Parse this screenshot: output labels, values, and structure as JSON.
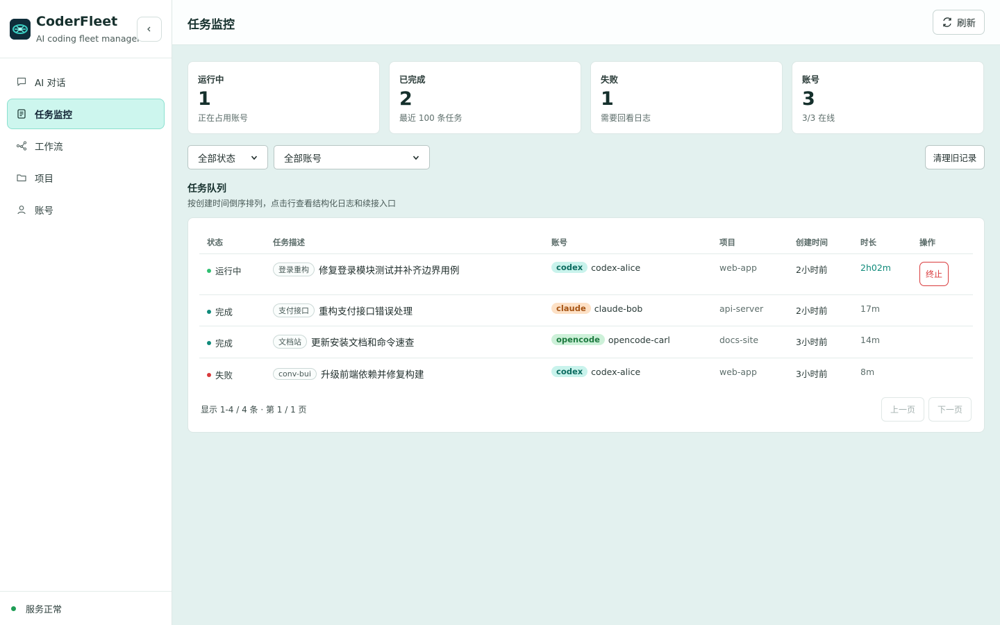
{
  "brand": {
    "name": "CoderFleet",
    "subtitle": "AI coding fleet manager"
  },
  "nav": [
    {
      "label": "AI 对话",
      "icon": "chat-icon",
      "active": false
    },
    {
      "label": "任务监控",
      "icon": "task-icon",
      "active": true
    },
    {
      "label": "工作流",
      "icon": "workflow-icon",
      "active": false
    },
    {
      "label": "项目",
      "icon": "folder-icon",
      "active": false
    },
    {
      "label": "账号",
      "icon": "user-icon",
      "active": false
    }
  ],
  "service_status": "服务正常",
  "header": {
    "title": "任务监控",
    "refresh_label": "刷新"
  },
  "stats": [
    {
      "label": "运行中",
      "value": "1",
      "sub": "正在占用账号"
    },
    {
      "label": "已完成",
      "value": "2",
      "sub": "最近 100 条任务"
    },
    {
      "label": "失败",
      "value": "1",
      "sub": "需要回看日志"
    },
    {
      "label": "账号",
      "value": "3",
      "sub": "3/3 在线"
    }
  ],
  "filters": {
    "status_selected": "全部状态",
    "account_selected": "全部账号",
    "clean_label": "清理旧记录"
  },
  "queue": {
    "title": "任务队列",
    "subtitle": "按创建时间倒序排列，点击行查看结构化日志和续接入口"
  },
  "table": {
    "columns": [
      "状态",
      "任务描述",
      "账号",
      "项目",
      "创建时间",
      "时长",
      "操作"
    ],
    "rows": [
      {
        "status": "运行中",
        "status_color": "#2fbf71",
        "tag": "登录重构",
        "desc": "修复登录模块测试并补齐边界用例",
        "agent": "codex",
        "account": "codex-alice",
        "project": "web-app",
        "created": "2小时前",
        "duration": "2h02m",
        "action": "终止"
      },
      {
        "status": "完成",
        "status_color": "#0f8a7a",
        "tag": "支付接口",
        "desc": "重构支付接口错误处理",
        "agent": "claude",
        "account": "claude-bob",
        "project": "api-server",
        "created": "2小时前",
        "duration": "17m",
        "action": ""
      },
      {
        "status": "完成",
        "status_color": "#0f8a7a",
        "tag": "文档站",
        "desc": "更新安装文档和命令速查",
        "agent": "opencode",
        "account": "opencode-carl",
        "project": "docs-site",
        "created": "3小时前",
        "duration": "14m",
        "action": ""
      },
      {
        "status": "失败",
        "status_color": "#d9393b",
        "tag": "conv-bui",
        "desc": "升级前端依赖并修复构建",
        "agent": "codex",
        "account": "codex-alice",
        "project": "web-app",
        "created": "3小时前",
        "duration": "8m",
        "action": ""
      }
    ]
  },
  "pagination": {
    "info": "显示 1-4 / 4 条 · 第 1 / 1 页",
    "prev_label": "上一页",
    "next_label": "下一页"
  },
  "colors": {
    "accent": "#0f8a7a",
    "codex_badge": "#c9f3ec",
    "claude_badge": "#fde1c6",
    "opencode_badge": "#cdf1d9",
    "danger": "#d9393b"
  }
}
